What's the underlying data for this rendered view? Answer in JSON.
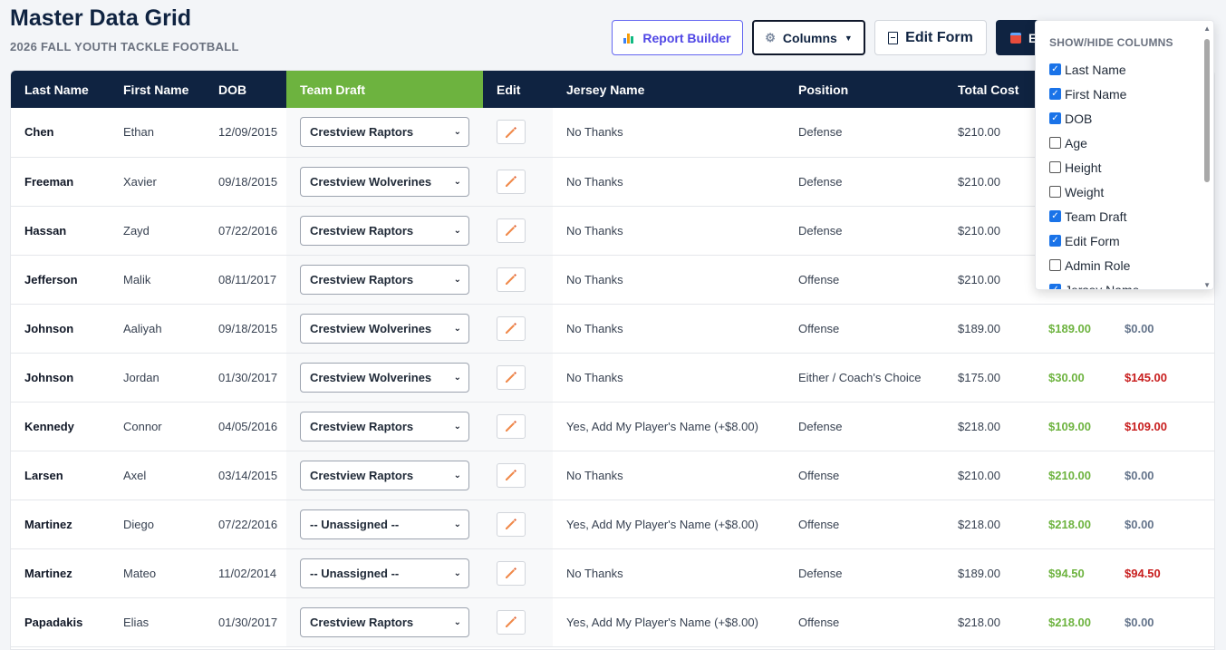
{
  "header": {
    "title": "Master Data Grid",
    "subtitle": "2026 FALL YOUTH TACKLE FOOTBALL"
  },
  "toolbar": {
    "report_builder": "Report Builder",
    "columns": "Columns",
    "edit_form": "Edit Form",
    "export_partial": "E"
  },
  "colors": {
    "navy": "#0f2341",
    "green": "#6db33f",
    "red": "#c81e1e",
    "accent": "#1a73e8"
  },
  "grid": {
    "columns": [
      "Last Name",
      "First Name",
      "DOB",
      "Team Draft",
      "Edit",
      "Jersey Name",
      "Position",
      "Total Cost"
    ],
    "rows": [
      {
        "last": "Chen",
        "first": "Ethan",
        "dob": "12/09/2015",
        "team": "Crestview Raptors",
        "jersey": "No Thanks",
        "position": "Defense",
        "total": "$210.00",
        "paid": "",
        "balance": ""
      },
      {
        "last": "Freeman",
        "first": "Xavier",
        "dob": "09/18/2015",
        "team": "Crestview Wolverines",
        "jersey": "No Thanks",
        "position": "Defense",
        "total": "$210.00",
        "paid": "",
        "balance": ""
      },
      {
        "last": "Hassan",
        "first": "Zayd",
        "dob": "07/22/2016",
        "team": "Crestview Raptors",
        "jersey": "No Thanks",
        "position": "Defense",
        "total": "$210.00",
        "paid": "",
        "balance": ""
      },
      {
        "last": "Jefferson",
        "first": "Malik",
        "dob": "08/11/2017",
        "team": "Crestview Raptors",
        "jersey": "No Thanks",
        "position": "Offense",
        "total": "$210.00",
        "paid": "",
        "balance": ""
      },
      {
        "last": "Johnson",
        "first": "Aaliyah",
        "dob": "09/18/2015",
        "team": "Crestview Wolverines",
        "jersey": "No Thanks",
        "position": "Offense",
        "total": "$189.00",
        "paid": "$189.00",
        "balance": "$0.00"
      },
      {
        "last": "Johnson",
        "first": "Jordan",
        "dob": "01/30/2017",
        "team": "Crestview Wolverines",
        "jersey": "No Thanks",
        "position": "Either / Coach's Choice",
        "total": "$175.00",
        "paid": "$30.00",
        "balance": "$145.00"
      },
      {
        "last": "Kennedy",
        "first": "Connor",
        "dob": "04/05/2016",
        "team": "Crestview Raptors",
        "jersey": "Yes, Add My Player's Name (+$8.00)",
        "position": "Defense",
        "total": "$218.00",
        "paid": "$109.00",
        "balance": "$109.00"
      },
      {
        "last": "Larsen",
        "first": "Axel",
        "dob": "03/14/2015",
        "team": "Crestview Raptors",
        "jersey": "No Thanks",
        "position": "Offense",
        "total": "$210.00",
        "paid": "$210.00",
        "balance": "$0.00"
      },
      {
        "last": "Martinez",
        "first": "Diego",
        "dob": "07/22/2016",
        "team": "-- Unassigned --",
        "jersey": "Yes, Add My Player's Name (+$8.00)",
        "position": "Offense",
        "total": "$218.00",
        "paid": "$218.00",
        "balance": "$0.00"
      },
      {
        "last": "Martinez",
        "first": "Mateo",
        "dob": "11/02/2014",
        "team": "-- Unassigned --",
        "jersey": "No Thanks",
        "position": "Defense",
        "total": "$189.00",
        "paid": "$94.50",
        "balance": "$94.50"
      },
      {
        "last": "Papadakis",
        "first": "Elias",
        "dob": "01/30/2017",
        "team": "Crestview Raptors",
        "jersey": "Yes, Add My Player's Name (+$8.00)",
        "position": "Offense",
        "total": "$218.00",
        "paid": "$218.00",
        "balance": "$0.00"
      }
    ]
  },
  "columns_panel": {
    "title": "SHOW/HIDE COLUMNS",
    "items": [
      {
        "label": "Last Name",
        "checked": true
      },
      {
        "label": "First Name",
        "checked": true
      },
      {
        "label": "DOB",
        "checked": true
      },
      {
        "label": "Age",
        "checked": false
      },
      {
        "label": "Height",
        "checked": false
      },
      {
        "label": "Weight",
        "checked": false
      },
      {
        "label": "Team Draft",
        "checked": true
      },
      {
        "label": "Edit Form",
        "checked": true
      },
      {
        "label": "Admin Role",
        "checked": false
      },
      {
        "label": "Jersey Name",
        "checked": true
      }
    ]
  }
}
